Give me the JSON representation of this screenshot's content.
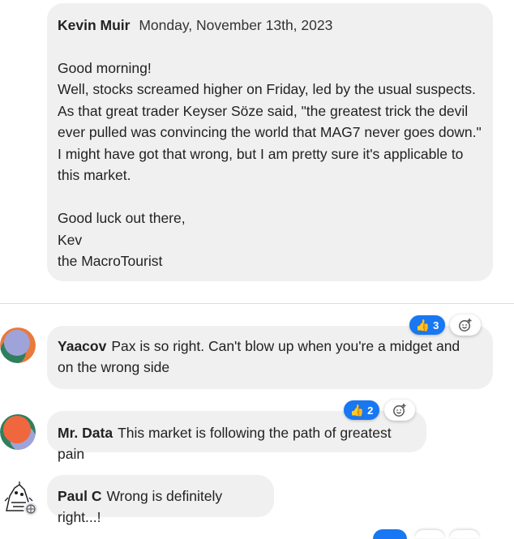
{
  "post": {
    "author": "Kevin Muir",
    "date": "Monday, November 13th, 2023",
    "body": "Good morning!\nWell, stocks screamed higher on Friday, led by the usual suspects. As that great trader Keyser Söze said, \"the greatest trick the devil ever pulled was convincing the world that MAG7 never goes down.\" I might have got that wrong, but I am pretty sure it's applicable to this market.\n\nGood luck out there,\nKev\nthe MacroTourist"
  },
  "comments": [
    {
      "author": "Yaacov",
      "text": "Pax is so right. Can't blow up when you're a midget and on the wrong side",
      "reactions": "3"
    },
    {
      "author": "Mr. Data",
      "text": "This market is following the path of greatest pain",
      "reactions": "2"
    },
    {
      "author": "Paul C",
      "text": "Wrong is definitely right...!"
    }
  ],
  "icons": {
    "reaction": "thumbs-up-icon",
    "add_reaction": "add-reaction-icon",
    "avatar_badge": "globe-badge-icon"
  },
  "colors": {
    "bubble": "#f0f0f0",
    "reaction_blue": "#1877f2"
  }
}
